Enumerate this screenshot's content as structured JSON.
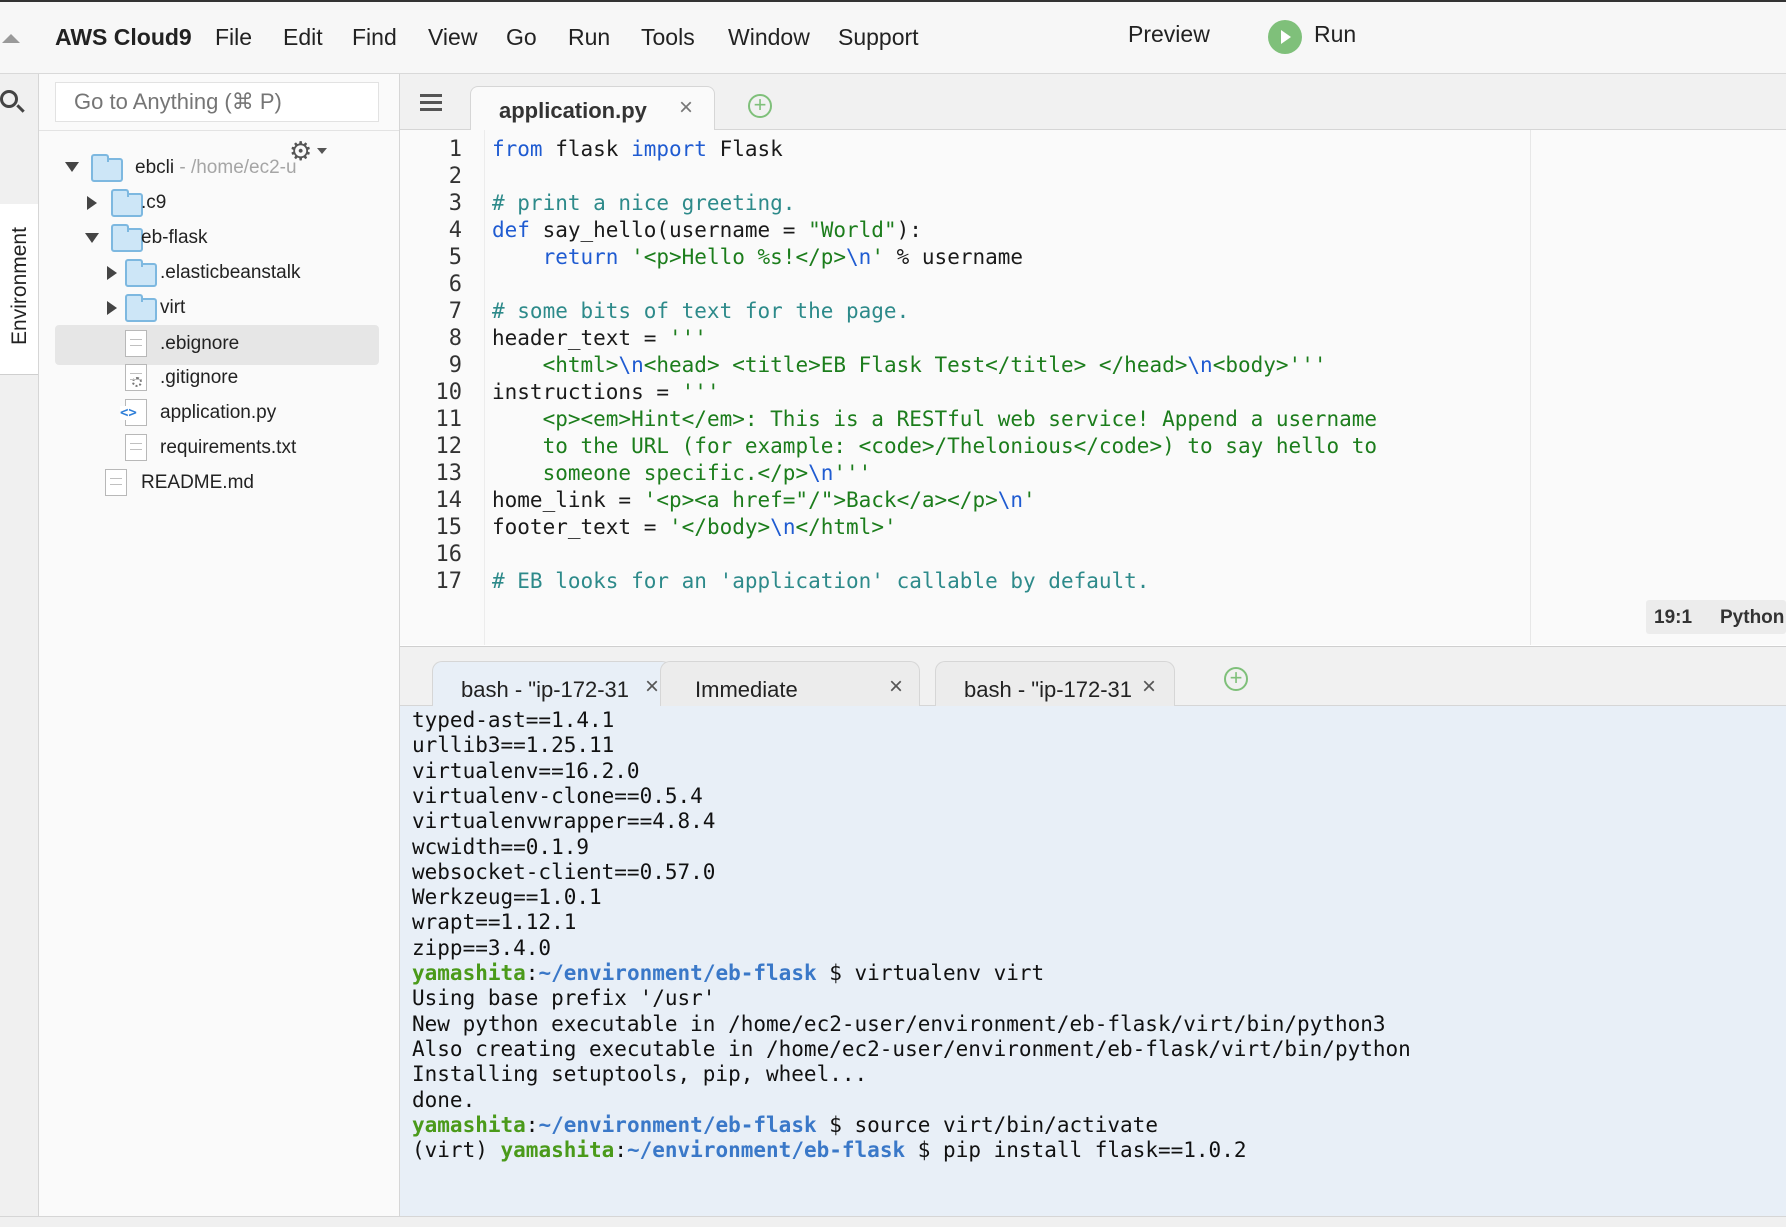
{
  "menubar": {
    "brand": "AWS Cloud9",
    "items": [
      "File",
      "Edit",
      "Find",
      "View",
      "Go",
      "Run",
      "Tools",
      "Window",
      "Support"
    ],
    "preview": "Preview",
    "run": "Run"
  },
  "sidebar": {
    "tab_label": "Environment",
    "search_placeholder": "Go to Anything (⌘ P)"
  },
  "tree": {
    "root_name": "ebcli",
    "root_path": " - /home/ec2-u",
    "items": [
      {
        "label": ".c9",
        "kind": "folder",
        "state": "collapsed"
      },
      {
        "label": "eb-flask",
        "kind": "folder",
        "state": "expanded"
      },
      {
        "label": ".elasticbeanstalk",
        "kind": "folder",
        "state": "collapsed"
      },
      {
        "label": "virt",
        "kind": "folder",
        "state": "collapsed"
      },
      {
        "label": ".ebignore",
        "kind": "file",
        "selected": true
      },
      {
        "label": ".gitignore",
        "kind": "file-config"
      },
      {
        "label": "application.py",
        "kind": "file-python"
      },
      {
        "label": "requirements.txt",
        "kind": "file"
      },
      {
        "label": "README.md",
        "kind": "file"
      }
    ]
  },
  "editor": {
    "tab_label": "application.py",
    "close_glyph": "×",
    "line_numbers": [
      "1",
      "2",
      "3",
      "4",
      "5",
      "6",
      "7",
      "8",
      "9",
      "10",
      "11",
      "12",
      "13",
      "14",
      "15",
      "16",
      "17"
    ],
    "lines": [
      [
        {
          "t": "from",
          "c": "kw"
        },
        {
          "t": " flask "
        },
        {
          "t": "import",
          "c": "kw"
        },
        {
          "t": " Flask"
        }
      ],
      [],
      [
        {
          "t": "# print a nice greeting.",
          "c": "cm"
        }
      ],
      [
        {
          "t": "def",
          "c": "kw"
        },
        {
          "t": " say_hello(username = "
        },
        {
          "t": "\"World\"",
          "c": "str"
        },
        {
          "t": "):"
        }
      ],
      [
        {
          "t": "    "
        },
        {
          "t": "return",
          "c": "kw"
        },
        {
          "t": " "
        },
        {
          "t": "'<p>Hello %s!</p>",
          "c": "str"
        },
        {
          "t": "\\n",
          "c": "esc"
        },
        {
          "t": "'",
          "c": "str"
        },
        {
          "t": " % username"
        }
      ],
      [],
      [
        {
          "t": "# some bits of text for the page.",
          "c": "cm"
        }
      ],
      [
        {
          "t": "header_text = "
        },
        {
          "t": "'''",
          "c": "str"
        }
      ],
      [
        {
          "t": "    "
        },
        {
          "t": "<html>",
          "c": "str"
        },
        {
          "t": "\\n",
          "c": "esc"
        },
        {
          "t": "<head> <title>EB Flask Test</title> </head>",
          "c": "str"
        },
        {
          "t": "\\n",
          "c": "esc"
        },
        {
          "t": "<body>'''",
          "c": "str"
        }
      ],
      [
        {
          "t": "instructions = "
        },
        {
          "t": "'''",
          "c": "str"
        }
      ],
      [
        {
          "t": "    "
        },
        {
          "t": "<p><em>Hint</em>: This is a RESTful web service! Append a username",
          "c": "str"
        }
      ],
      [
        {
          "t": "    "
        },
        {
          "t": "to the URL (for example: <code>/Thelonious</code>) to say hello to",
          "c": "str"
        }
      ],
      [
        {
          "t": "    "
        },
        {
          "t": "someone specific.</p>",
          "c": "str"
        },
        {
          "t": "\\n",
          "c": "esc"
        },
        {
          "t": "'''",
          "c": "str"
        }
      ],
      [
        {
          "t": "home_link = "
        },
        {
          "t": "'<p><a href=\"/\">Back</a></p>",
          "c": "str"
        },
        {
          "t": "\\n",
          "c": "esc"
        },
        {
          "t": "'",
          "c": "str"
        }
      ],
      [
        {
          "t": "footer_text = "
        },
        {
          "t": "'</body>",
          "c": "str"
        },
        {
          "t": "\\n",
          "c": "esc"
        },
        {
          "t": "</html>'",
          "c": "str"
        }
      ],
      [],
      [
        {
          "t": "# EB looks for an 'application' callable by default.",
          "c": "cm"
        }
      ]
    ],
    "status_position": "19:1",
    "status_language": "Python"
  },
  "terminal": {
    "tabs": [
      {
        "label": "bash - \"ip-172-31",
        "close": "×"
      },
      {
        "label": "Immediate",
        "close": "×"
      },
      {
        "label": "bash - \"ip-172-31",
        "close": "×"
      }
    ],
    "lines": [
      [
        {
          "t": "typed-ast==1.4.1"
        }
      ],
      [
        {
          "t": "urllib3==1.25.11"
        }
      ],
      [
        {
          "t": "virtualenv==16.2.0"
        }
      ],
      [
        {
          "t": "virtualenv-clone==0.5.4"
        }
      ],
      [
        {
          "t": "virtualenvwrapper==4.8.4"
        }
      ],
      [
        {
          "t": "wcwidth==0.1.9"
        }
      ],
      [
        {
          "t": "websocket-client==0.57.0"
        }
      ],
      [
        {
          "t": "Werkzeug==1.0.1"
        }
      ],
      [
        {
          "t": "wrapt==1.12.1"
        }
      ],
      [
        {
          "t": "zipp==3.4.0"
        }
      ],
      [
        {
          "t": "yamashita",
          "c": "p-user"
        },
        {
          "t": ":"
        },
        {
          "t": "~/environment/eb-flask",
          "c": "p-path"
        },
        {
          "t": " $ virtualenv virt"
        }
      ],
      [
        {
          "t": "Using base prefix '/usr'"
        }
      ],
      [
        {
          "t": "New python executable in /home/ec2-user/environment/eb-flask/virt/bin/python3"
        }
      ],
      [
        {
          "t": "Also creating executable in /home/ec2-user/environment/eb-flask/virt/bin/python"
        }
      ],
      [
        {
          "t": "Installing setuptools, pip, wheel..."
        }
      ],
      [
        {
          "t": "done."
        }
      ],
      [
        {
          "t": "yamashita",
          "c": "p-user"
        },
        {
          "t": ":"
        },
        {
          "t": "~/environment/eb-flask",
          "c": "p-path"
        },
        {
          "t": " $ source virt/bin/activate"
        }
      ],
      [
        {
          "t": "(virt) "
        },
        {
          "t": "yamashita",
          "c": "p-user"
        },
        {
          "t": ":"
        },
        {
          "t": "~/environment/eb-flask",
          "c": "p-path"
        },
        {
          "t": " $ pip install flask==1.0.2"
        }
      ]
    ]
  }
}
